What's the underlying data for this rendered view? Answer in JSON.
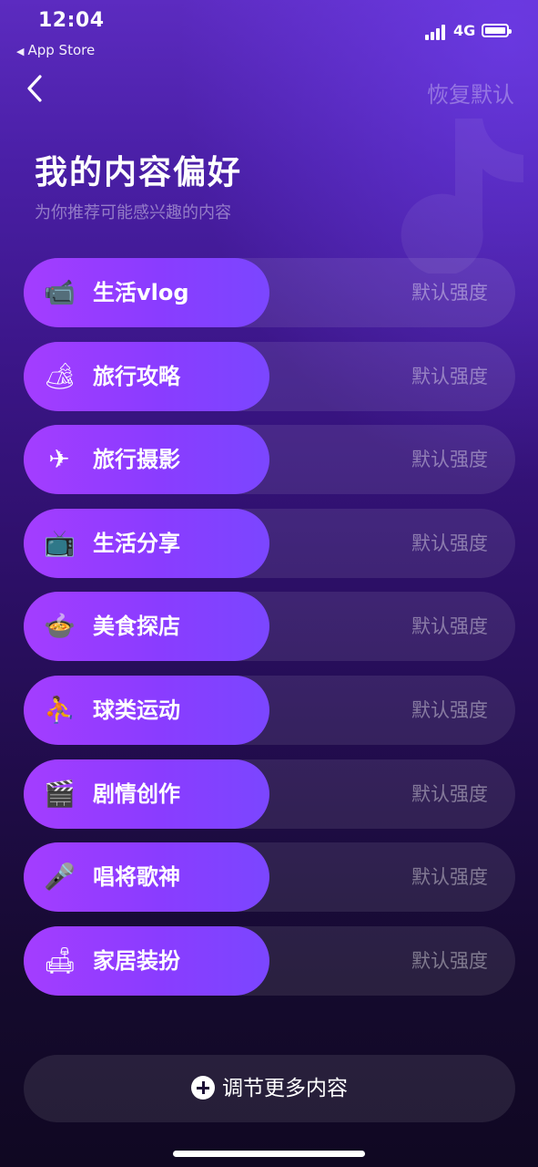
{
  "status_bar": {
    "time": "12:04",
    "back_to_app": "App Store",
    "network": "4G"
  },
  "header": {
    "back_icon": "chevron-left-icon",
    "reset_label": "恢复默认"
  },
  "title": "我的内容偏好",
  "subtitle": "为你推荐可能感兴趣的内容",
  "preferences": [
    {
      "label": "生活vlog",
      "level": "默认强度",
      "icon": "video-camera-icon",
      "glyph": "📹"
    },
    {
      "label": "旅行攻略",
      "level": "默认强度",
      "icon": "camping-icon",
      "glyph": "🏕"
    },
    {
      "label": "旅行摄影",
      "level": "默认强度",
      "icon": "airplane-icon",
      "glyph": "✈"
    },
    {
      "label": "生活分享",
      "level": "默认强度",
      "icon": "tv-icon",
      "glyph": "📺"
    },
    {
      "label": "美食探店",
      "level": "默认强度",
      "icon": "food-bowl-icon",
      "glyph": "🍲"
    },
    {
      "label": "球类运动",
      "level": "默认强度",
      "icon": "sports-player-icon",
      "glyph": "⛹"
    },
    {
      "label": "剧情创作",
      "level": "默认强度",
      "icon": "film-icon",
      "glyph": "🎬"
    },
    {
      "label": "唱将歌神",
      "level": "默认强度",
      "icon": "singer-icon",
      "glyph": "🎤"
    },
    {
      "label": "家居装扮",
      "level": "默认强度",
      "icon": "sofa-lamp-icon",
      "glyph": "🛋"
    }
  ],
  "more_button": {
    "label": "调节更多内容",
    "icon": "plus-circle-icon"
  },
  "colors": {
    "pill_start": "#a43dff",
    "pill_end": "#7b46ff",
    "background_top": "#5c2bc0",
    "background_bottom": "#100822"
  }
}
